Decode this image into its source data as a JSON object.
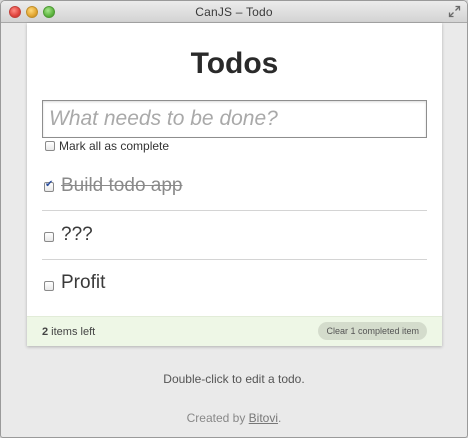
{
  "window": {
    "title": "CanJS – Todo"
  },
  "app": {
    "heading": "Todos",
    "new_todo_placeholder": "What needs to be done?",
    "mark_all_label": "Mark all as complete",
    "todos": [
      {
        "text": "Build todo app",
        "completed": true
      },
      {
        "text": "???",
        "completed": false
      },
      {
        "text": "Profit",
        "completed": false
      }
    ],
    "footer": {
      "items_left_count": "2",
      "items_left_label": " items left",
      "clear_label": "Clear 1 completed item"
    }
  },
  "info": {
    "hint": "Double-click to edit a todo.",
    "credit_prefix": "Created by ",
    "credit_link": "Bitovi",
    "credit_suffix": "."
  },
  "colors": {
    "footer_bg": "#eef7e6",
    "checkmark": "#2d4f9e"
  }
}
